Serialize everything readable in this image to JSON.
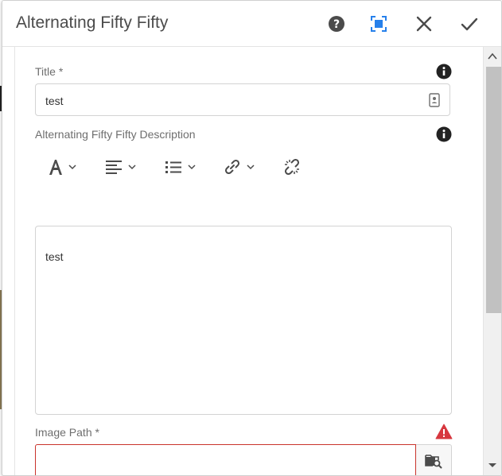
{
  "dialog": {
    "title": "Alternating Fifty Fifty",
    "actions": [
      "help-icon",
      "fullscreen-icon",
      "close-icon",
      "done-check-icon"
    ],
    "accent_color": "#2680eb",
    "error_color": "#c9332b"
  },
  "fields": {
    "title_label": "Title *",
    "title_value": "test",
    "description_label": "Alternating Fifty Fifty Description",
    "description_value": "test",
    "image_path_label": "Image Path *",
    "image_path_value": ""
  },
  "rte_toolbar": [
    "text-format-icon",
    "align-icon",
    "list-icon",
    "link-icon",
    "unlink-icon"
  ]
}
